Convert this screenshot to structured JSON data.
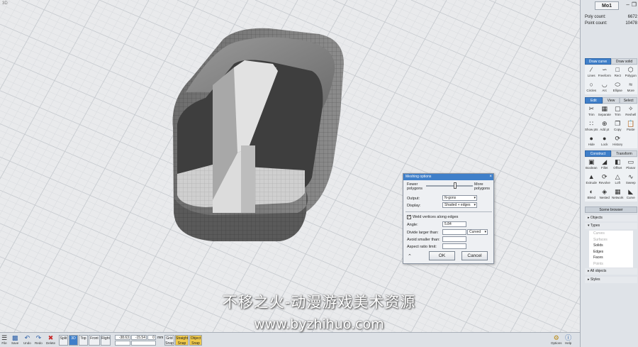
{
  "viewport": {
    "label": "3D"
  },
  "document_tab": "Mo1",
  "stats": {
    "poly_label": "Poly count:",
    "poly_value": "6672",
    "point_label": "Point count:",
    "point_value": "10478"
  },
  "draw_tabs": [
    "Draw curve",
    "Draw solid"
  ],
  "draw_tools": [
    "Lines",
    "Freeform",
    "Rect",
    "Polygon",
    "Circles",
    "Arc",
    "Ellipse",
    "More"
  ],
  "edit_tabs": [
    "Edit",
    "View",
    "Select"
  ],
  "edit_tools": [
    "Trim",
    "Separate",
    "Trim",
    "Reshell",
    "Show pts",
    "Add pt",
    "Copy",
    "Paste",
    "Hide",
    "Lock",
    "History",
    ""
  ],
  "construct_tabs": [
    "Construct",
    "Transform"
  ],
  "construct_tools": [
    "Boolean",
    "Fillet",
    "Offset",
    "Planar",
    "Extrude",
    "Revolve",
    "Loft",
    "Sweep",
    "Blend",
    "Nested",
    "Network",
    "Curve"
  ],
  "scene_browser": {
    "title": "Scene browser",
    "objects": "Objects",
    "types": "Types",
    "type_items": [
      "Curves",
      "Surfaces",
      "Solids",
      "Edges",
      "Faces",
      "Points"
    ],
    "type_dim": [
      true,
      true,
      false,
      false,
      false,
      true
    ],
    "all_objects": "All objects",
    "styles": "Styles"
  },
  "dialog": {
    "title": "Meshing options",
    "fewer": "Fewer\npolygons",
    "more": "More\npolygons",
    "slider_value": 0.62,
    "output_label": "Output:",
    "output_value": "N-gons",
    "display_label": "Display:",
    "display_value": "Shaded + edges",
    "weld_label": "Weld vertices along edges",
    "angle_label": "Angle:",
    "angle_value": "5.84",
    "divide_label": "Divide larger than:",
    "divide_mode": "Curved",
    "avoid_label": "Avoid smaller than:",
    "aspect_label": "Aspect ratio limit:",
    "ok": "OK",
    "cancel": "Cancel"
  },
  "statusbar": {
    "file": "File",
    "save": "Save",
    "undo": "Undo",
    "redo": "Redo",
    "delete": "Delete",
    "split": "Split",
    "view3d": "3D",
    "top": "Top",
    "front": "Front",
    "right": "Right",
    "coord_x": "-38.63",
    "coord_y": "-15.54",
    "coord_z": "0",
    "units": "mm",
    "grid_snap": "Grid Snap",
    "straight_snap": "Straight Snap",
    "object_snap": "Object Snap",
    "options": "Options",
    "help": "Help"
  },
  "watermark": {
    "line1": "不移之火-动漫游戏美术资源",
    "line2": "www.byzhihuo.com"
  },
  "colors": {
    "accent": "#3f7fc9",
    "snap_active": "#f0c94a",
    "model_dark": "#4a4a4a",
    "model_light": "#d8d8d8"
  }
}
